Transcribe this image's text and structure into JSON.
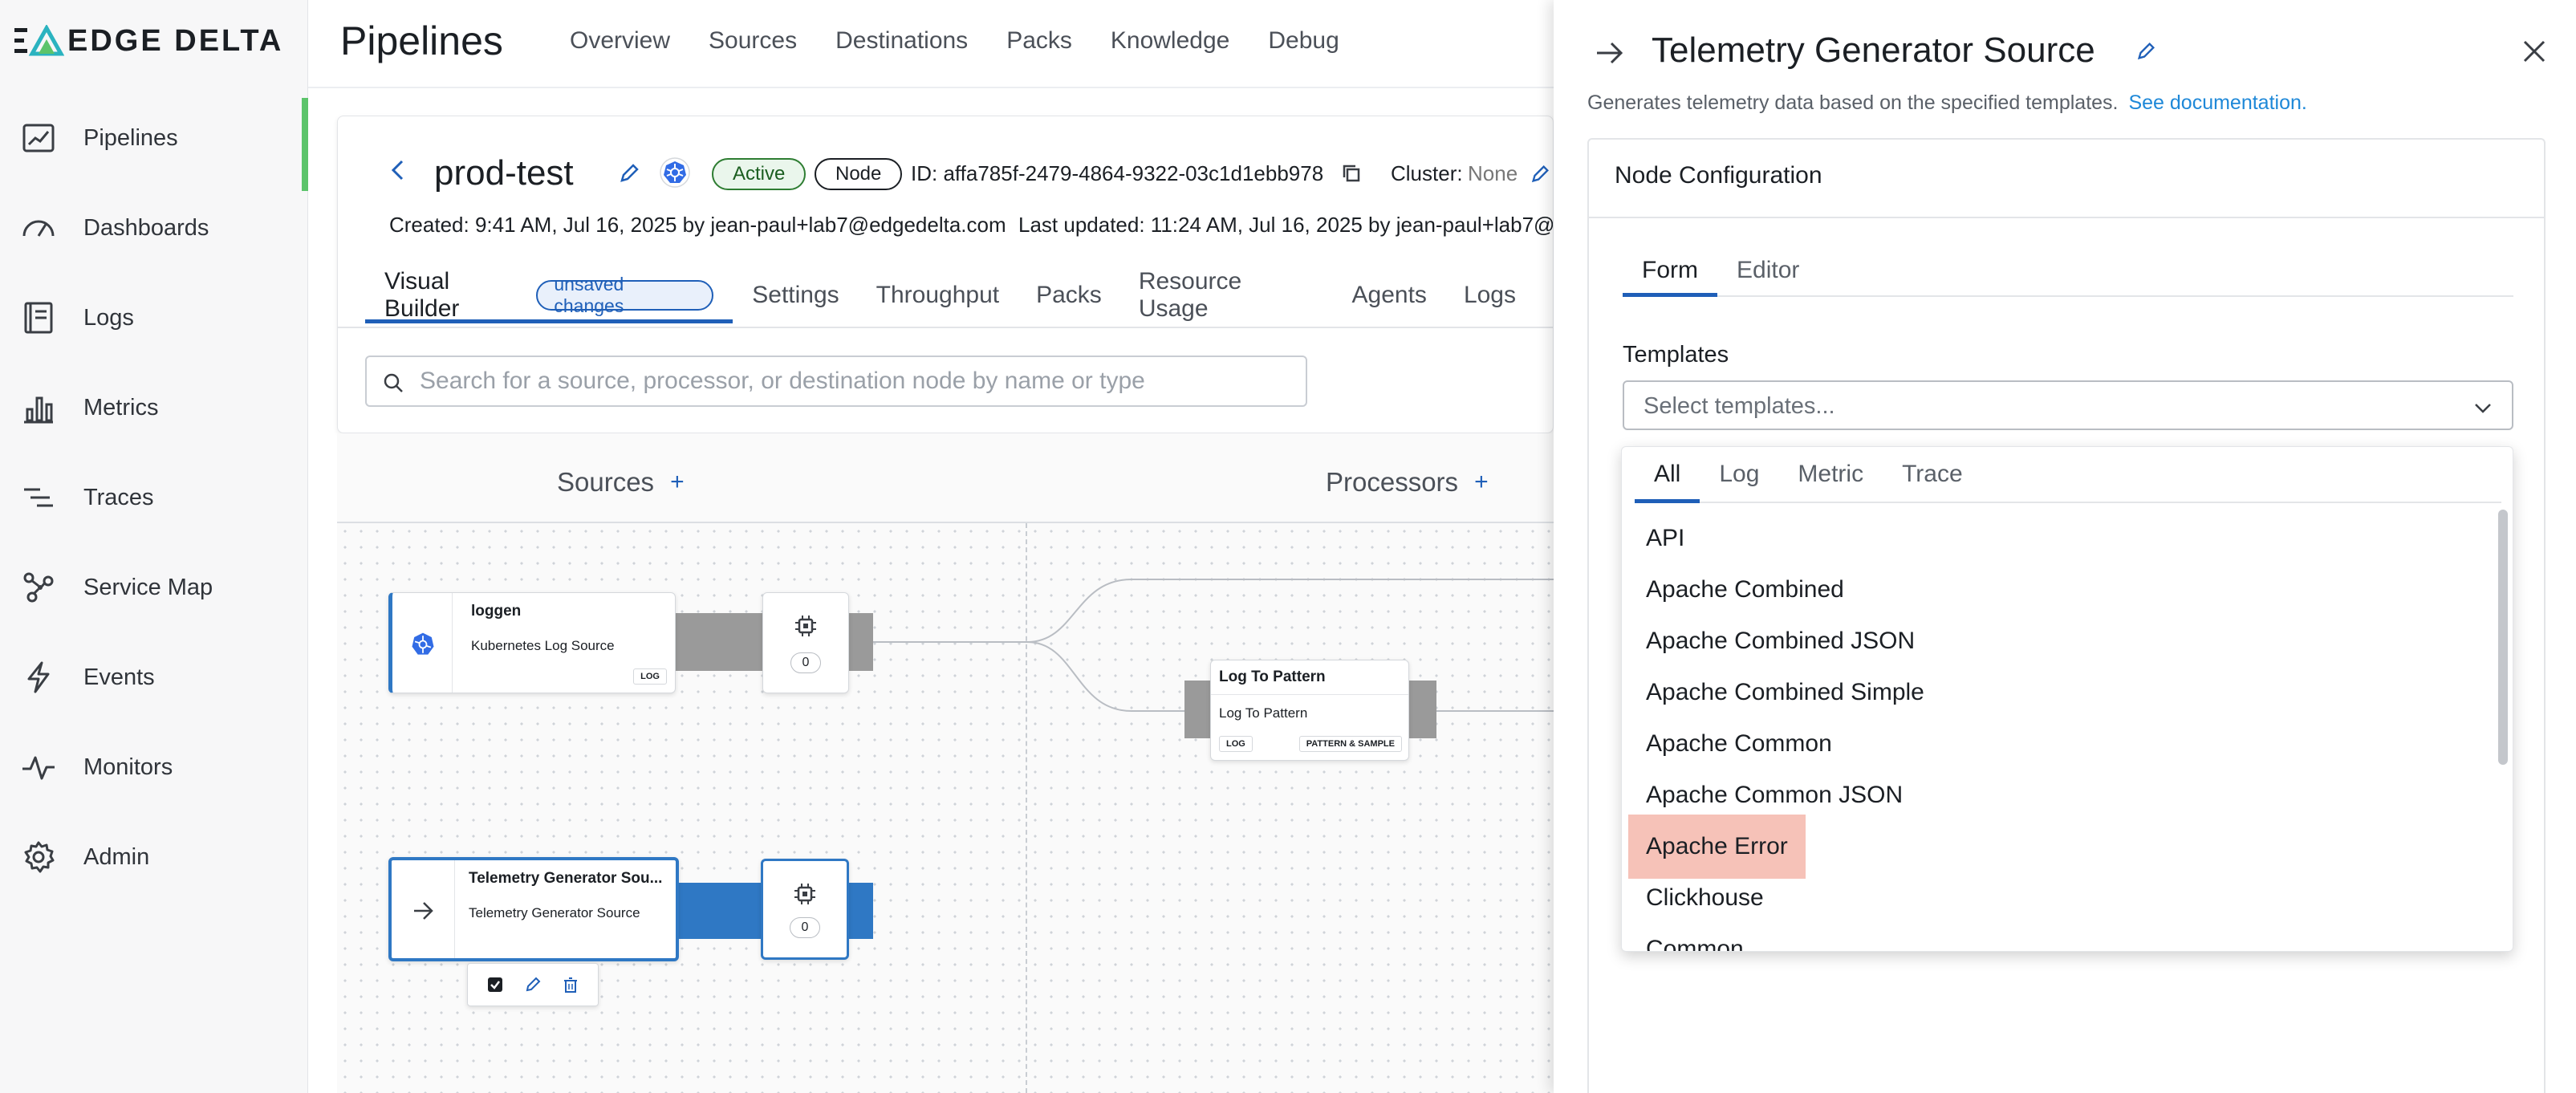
{
  "brand": {
    "logo_text": "EDGE DELTA"
  },
  "sidebar": {
    "items": [
      {
        "label": "Pipelines",
        "icon": "pipelines-icon"
      },
      {
        "label": "Dashboards",
        "icon": "gauge-icon"
      },
      {
        "label": "Logs",
        "icon": "logs-icon"
      },
      {
        "label": "Metrics",
        "icon": "bar-chart-icon"
      },
      {
        "label": "Traces",
        "icon": "traces-icon"
      },
      {
        "label": "Service Map",
        "icon": "graph-icon"
      },
      {
        "label": "Events",
        "icon": "lightning-icon"
      },
      {
        "label": "Monitors",
        "icon": "pulse-icon"
      },
      {
        "label": "Admin",
        "icon": "gear-icon"
      }
    ]
  },
  "header": {
    "title": "Pipelines",
    "tabs": [
      "Overview",
      "Sources",
      "Destinations",
      "Packs",
      "Knowledge",
      "Debug"
    ]
  },
  "pipeline": {
    "name": "prod-test",
    "status": "Active",
    "type": "Node",
    "id": "ID: affa785f-2479-4864-9322-03c1d1ebb978",
    "cluster_label": "Cluster:",
    "cluster_value": "None",
    "created": "Created: 9:41 AM, Jul 16, 2025 by jean-paul+lab7@edgedelta.com",
    "updated": "Last updated: 11:24 AM, Jul 16, 2025 by jean-paul+lab7@ed",
    "tabs": [
      "Visual Builder",
      "Settings",
      "Throughput",
      "Packs",
      "Resource Usage",
      "Agents",
      "Logs"
    ],
    "unsaved_badge": "unsaved changes",
    "search_placeholder": "Search for a source, processor, or destination node by name or type"
  },
  "canvas": {
    "columns": {
      "sources": "Sources",
      "processors": "Processors",
      "plus": "+"
    },
    "nodes": {
      "loggen": {
        "title": "loggen",
        "subtitle": "Kubernetes Log Source",
        "tag": "LOG",
        "count": "0"
      },
      "log_to_pattern": {
        "title": "Log To Pattern",
        "subtitle": "Log To Pattern",
        "tags": [
          "LOG",
          "PATTERN & SAMPLE"
        ]
      },
      "telemetry": {
        "title": "Telemetry Generator Sou...",
        "subtitle": "Telemetry Generator Source",
        "count": "0"
      }
    }
  },
  "panel": {
    "title": "Telemetry Generator Source",
    "description": "Generates telemetry data based on the specified templates.",
    "doc_link": "See documentation.",
    "section_title": "Node Configuration",
    "tabs": [
      "Form",
      "Editor"
    ],
    "templates_label": "Templates",
    "templates_placeholder": "Select templates...",
    "dropdown": {
      "tabs": [
        "All",
        "Log",
        "Metric",
        "Trace"
      ],
      "options": [
        "API",
        "Apache Combined",
        "Apache Combined JSON",
        "Apache Combined Simple",
        "Apache Common",
        "Apache Common JSON",
        "Apache Error",
        "Clickhouse",
        "Common"
      ],
      "highlighted": "Apache Error"
    }
  },
  "colors": {
    "accent_blue": "#1f5fb8",
    "active_green": "#5cc46b",
    "link": "#1e88d8",
    "highlight": "#f6c2b8"
  }
}
